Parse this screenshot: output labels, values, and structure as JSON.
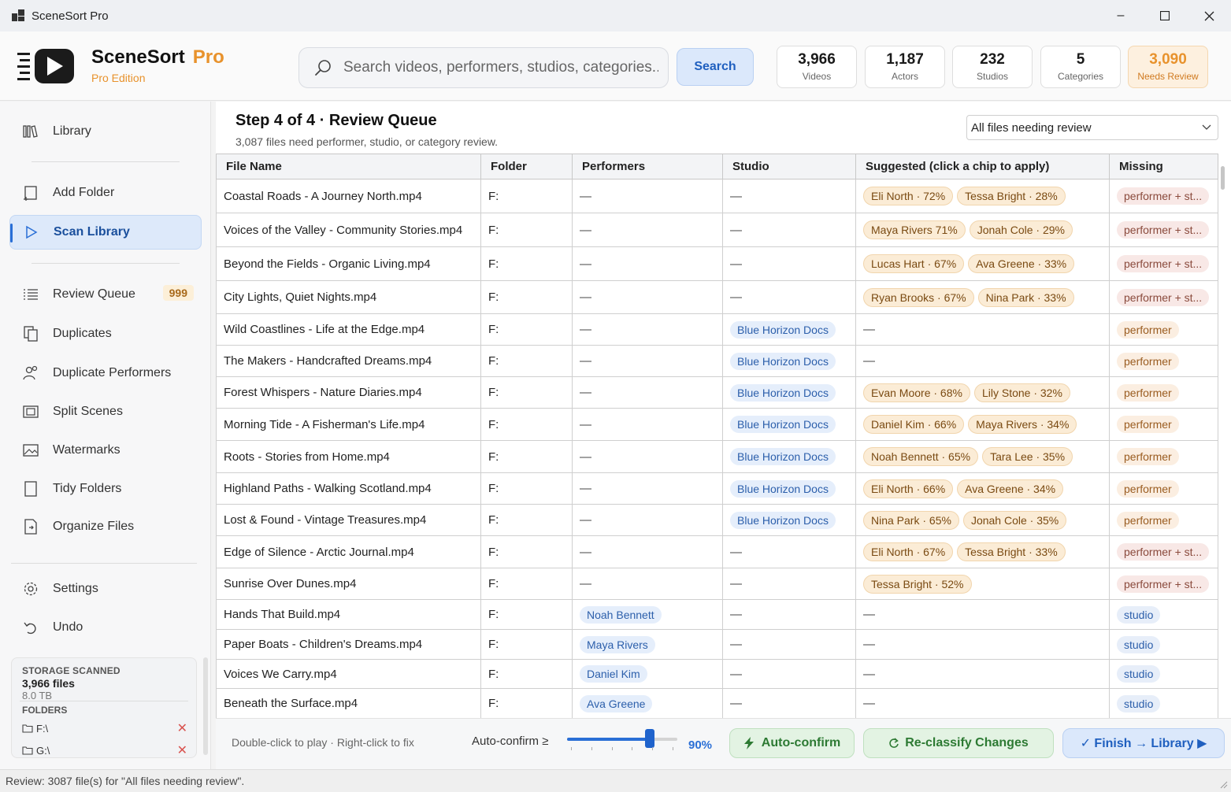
{
  "window": {
    "title": "SceneSort Pro"
  },
  "brand": {
    "name": "SceneSort",
    "pro": "Pro",
    "edition": "Pro Edition"
  },
  "search": {
    "placeholder": "Search videos, performers, studios, categories...",
    "button": "Search"
  },
  "stats": [
    {
      "value": "3,966",
      "label": "Videos"
    },
    {
      "value": "1,187",
      "label": "Actors"
    },
    {
      "value": "232",
      "label": "Studios"
    },
    {
      "value": "5",
      "label": "Categories"
    },
    {
      "value": "3,090",
      "label": "Needs Review"
    }
  ],
  "sidebar": {
    "library": "Library",
    "add_folder": "Add Folder",
    "scan_library": "Scan Library",
    "review_queue": "Review Queue",
    "review_badge": "999",
    "duplicates": "Duplicates",
    "duplicate_performers": "Duplicate Performers",
    "split_scenes": "Split Scenes",
    "watermarks": "Watermarks",
    "tidy_folders": "Tidy Folders",
    "organize_files": "Organize Files",
    "settings": "Settings",
    "undo": "Undo",
    "storage": {
      "heading": "STORAGE SCANNED",
      "files": "3,966 files",
      "size": "8.0 TB",
      "folders_heading": "FOLDERS",
      "folders": [
        "F:\\",
        "G:\\"
      ],
      "remove_glyph": "✕"
    }
  },
  "main": {
    "step_title": "Step 4 of 4  ·  Review Queue",
    "step_sub": "3,087 files need performer, studio, or category review.",
    "filter": "All files needing review",
    "columns": [
      "File Name",
      "Folder",
      "Performers",
      "Studio",
      "Suggested (click a chip to apply)",
      "Missing"
    ],
    "rows": [
      {
        "file": "Coastal Roads - A Journey North.mp4",
        "folder": "F:",
        "performers": "—",
        "studio": "—",
        "suggested": [
          "Eli North · 72%",
          "Tessa Bright · 28%"
        ],
        "missing": "performer + st..."
      },
      {
        "file": "Voices of the Valley - Community Stories.mp4",
        "folder": "F:",
        "performers": "—",
        "studio": "—",
        "suggested": [
          "Maya Rivers  71%",
          "Jonah Cole · 29%"
        ],
        "missing": "performer + st..."
      },
      {
        "file": "Beyond the Fields - Organic Living.mp4",
        "folder": "F:",
        "performers": "—",
        "studio": "—",
        "suggested": [
          "Lucas Hart · 67%",
          "Ava Greene · 33%"
        ],
        "missing": "performer + st..."
      },
      {
        "file": "City Lights, Quiet Nights.mp4",
        "folder": "F:",
        "performers": "—",
        "studio": "—",
        "suggested": [
          "Ryan Brooks · 67%",
          "Nina Park · 33%"
        ],
        "missing": "performer + st..."
      },
      {
        "file": "Wild Coastlines - Life at the Edge.mp4",
        "folder": "F:",
        "performers": "—",
        "studio": "Blue Horizon Docs",
        "suggested": [],
        "missing": "performer"
      },
      {
        "file": "The Makers - Handcrafted Dreams.mp4",
        "folder": "F:",
        "performers": "—",
        "studio": "Blue Horizon Docs",
        "suggested": [],
        "missing": "performer"
      },
      {
        "file": "Forest Whispers - Nature Diaries.mp4",
        "folder": "F:",
        "performers": "—",
        "studio": "Blue Horizon Docs",
        "suggested": [
          "Evan Moore · 68%",
          "Lily Stone · 32%"
        ],
        "missing": "performer"
      },
      {
        "file": "Morning Tide - A Fisherman's Life.mp4",
        "folder": "F:",
        "performers": "—",
        "studio": "Blue Horizon Docs",
        "suggested": [
          "Daniel Kim · 66%",
          "Maya Rivers · 34%"
        ],
        "missing": "performer"
      },
      {
        "file": "Roots - Stories from Home.mp4",
        "folder": "F:",
        "performers": "—",
        "studio": "Blue Horizon Docs",
        "suggested": [
          "Noah Bennett · 65%",
          "Tara Lee · 35%"
        ],
        "missing": "performer"
      },
      {
        "file": "Highland Paths - Walking Scotland.mp4",
        "folder": "F:",
        "performers": "—",
        "studio": "Blue Horizon Docs",
        "suggested": [
          "Eli North · 66%",
          "Ava Greene · 34%"
        ],
        "missing": "performer"
      },
      {
        "file": "Lost & Found - Vintage Treasures.mp4",
        "folder": "F:",
        "performers": "—",
        "studio": "Blue Horizon Docs",
        "suggested": [
          "Nina Park · 65%",
          "Jonah Cole · 35%"
        ],
        "missing": "performer"
      },
      {
        "file": "Edge of Silence - Arctic Journal.mp4",
        "folder": "F:",
        "performers": "—",
        "studio": "—",
        "suggested": [
          "Eli North · 67%",
          "Tessa Bright · 33%"
        ],
        "missing": "performer + st..."
      },
      {
        "file": "Sunrise Over Dunes.mp4",
        "folder": "F:",
        "performers": "—",
        "studio": "—",
        "suggested": [
          "Tessa Bright · 52%"
        ],
        "missing": "performer + st..."
      },
      {
        "file": "Hands That Build.mp4",
        "folder": "F:",
        "performers": "Noah Bennett",
        "studio": "—",
        "suggested": [],
        "missing": "studio"
      },
      {
        "file": "Paper Boats - Children's Dreams.mp4",
        "folder": "F:",
        "performers": "Maya Rivers",
        "studio": "—",
        "suggested": [],
        "missing": "studio"
      },
      {
        "file": "Voices We Carry.mp4",
        "folder": "F:",
        "performers": "Daniel Kim",
        "studio": "—",
        "suggested": [],
        "missing": "studio"
      },
      {
        "file": "Beneath the Surface.mp4",
        "folder": "F:",
        "performers": "Ava Greene",
        "studio": "—",
        "suggested": [],
        "missing": "studio"
      }
    ]
  },
  "footer": {
    "hint": "Double-click to play  ·  Right-click to fix",
    "auto_confirm_label": "Auto-confirm ≥",
    "auto_confirm_value": "90%",
    "auto_confirm_level": 0.75,
    "auto_confirm_button": "Auto-confirm",
    "reclassify_button": "Re-classify Changes",
    "finish_button": "✓ Finish → Library ▶"
  },
  "status": "Review: 3087 file(s) for \"All files needing review\".",
  "colors": {
    "accent": "#2a6fd6",
    "brand_orange": "#e8922c",
    "suggest_chip": "#fbecd6",
    "studio_chip": "#e5eefb"
  }
}
